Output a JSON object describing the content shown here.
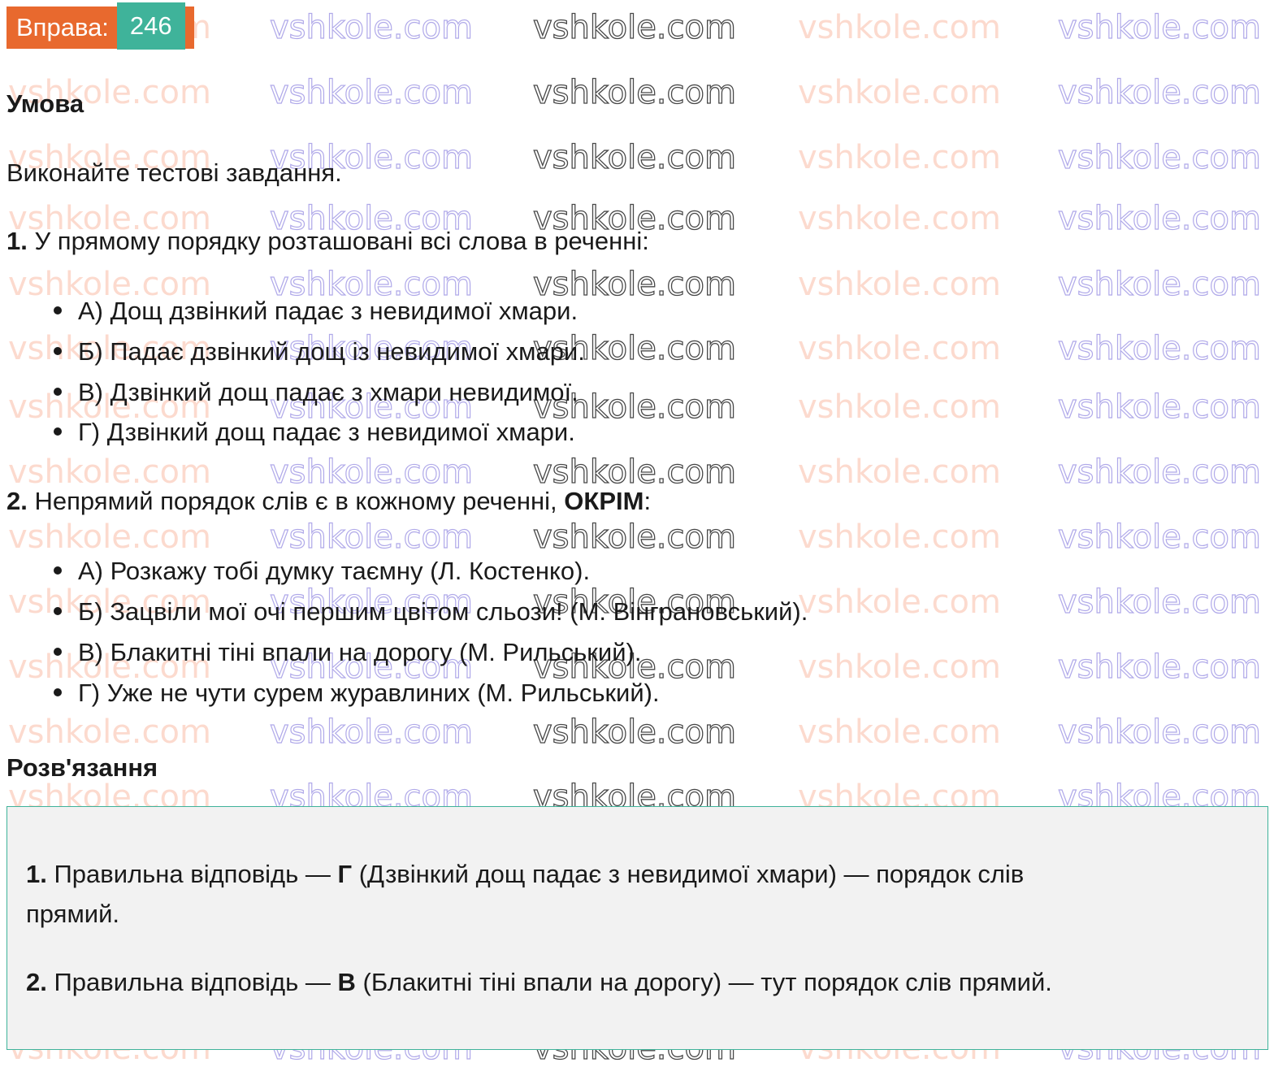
{
  "badge": {
    "label": "Вправа:",
    "number": "246"
  },
  "watermark": "vshkole.com",
  "colors": {
    "badge_label_bg": "#e8692e",
    "badge_number_bg": "#3fb39a",
    "solution_border": "#3fb39a",
    "solution_bg": "#f2f2f2"
  },
  "condition": {
    "heading": "Умова",
    "instruction": "Виконайте тестові завдання.",
    "questions": [
      {
        "number": "1.",
        "text": " У прямому порядку розташовані всі слова в реченні:",
        "options": [
          "А) Дощ дзвінкий падає з невидимої хмари.",
          "Б) Падає дзвінкий дощ із невидимої хмари.",
          "В) Дзвінкий дощ падає з хмари невидимої.",
          "Г) Дзвінкий дощ падає з невидимої хмари."
        ]
      },
      {
        "number": "2.",
        "text_before": " Непрямий порядок слів є в кожному реченні, ",
        "text_bold": "ОКРІМ",
        "text_after": ":",
        "options": [
          "А) Розкажу тобі думку таємну (Л. Костенко).",
          "Б) Зацвіли мої очі першим цвітом сльози! (М. Вінграновський).",
          "В) Блакитні тіні впали на дорогу (М. Рильський).",
          "Г) Уже не чути сурем журавлиних (М. Рильський)."
        ]
      }
    ]
  },
  "solution": {
    "heading": "Розв'язання",
    "answers": [
      {
        "number": "1.",
        "before": " Правильна відповідь — ",
        "letter": "Г",
        "after_line1": " (Дзвінкий дощ падає з невидимої хмари) — порядок слів",
        "after_line2": "прямий."
      },
      {
        "number": "2.",
        "before": " Правильна відповідь — ",
        "letter": "В",
        "after": " (Блакитні тіні впали на дорогу) — тут порядок слів прямий."
      }
    ]
  }
}
